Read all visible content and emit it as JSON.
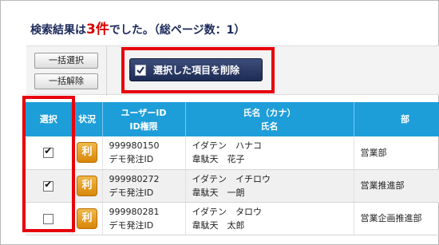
{
  "header": {
    "prefix": "検索結果は",
    "count": "3件",
    "suffix": "でした。（総ページ数：1）"
  },
  "toolbar": {
    "select_all": "一括選択",
    "deselect_all": "一括解除",
    "delete_selected": "選択した項目を削除"
  },
  "table": {
    "headers": {
      "select": "選択",
      "status": "状況",
      "user_line1": "ユーザーID",
      "user_line2": "ID権限",
      "name_line1": "氏名（カナ）",
      "name_line2": "氏名",
      "dept": "部"
    },
    "rows": [
      {
        "checked": true,
        "status": "利",
        "user_id": "999980150",
        "role": "デモ発注ID",
        "kana": "イダテン　ハナコ",
        "name": "韋駄天　花子",
        "dept": "営業部"
      },
      {
        "checked": true,
        "status": "利",
        "user_id": "999980272",
        "role": "デモ発注ID",
        "kana": "イダテン　イチロウ",
        "name": "韋駄天　一朗",
        "dept": "営業推進部"
      },
      {
        "checked": false,
        "status": "利",
        "user_id": "999980281",
        "role": "デモ発注ID",
        "kana": "イダテン　タロウ",
        "name": "韋駄天　太郎",
        "dept": "営業企画推進部"
      }
    ]
  },
  "colors": {
    "header_bg": "#1d9ed9",
    "highlight": "#e8000b",
    "badge": "#e39a1c",
    "title": "#1c2a5a"
  }
}
